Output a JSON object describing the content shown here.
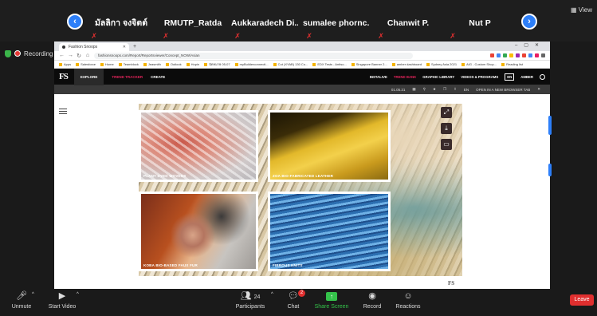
{
  "zoom": {
    "view_label": "View",
    "recording_label": "Recording",
    "participants": [
      {
        "name": "มัลลิกา จงจิตต์"
      },
      {
        "name": "RMUTP_Ratda"
      },
      {
        "name": "Aukkaradech Di..."
      },
      {
        "name": "sumalee phornc..."
      },
      {
        "name": "Chanwit P."
      },
      {
        "name": "Nut P"
      }
    ],
    "toolbar": {
      "unmute": "Unmute",
      "start_video": "Start Video",
      "participants": "Participants",
      "participant_count": "24",
      "chat": "Chat",
      "chat_badge": "2",
      "share_screen": "Share Screen",
      "record": "Record",
      "reactions": "Reactions",
      "leave": "Leave"
    }
  },
  "browser": {
    "tab_title": "Fashion Snoops",
    "url": "fashionsnoops.com/Report/Reportsviewer/Concept_NOW/Asian",
    "bookmarks": [
      "Apps",
      "Salesforce",
      "Home",
      "Teamblock",
      "Jeasmith",
      "Outlook",
      "Hopin",
      "นัดหมาย 05-07",
      "myBuilderconnecti...",
      "Cut (XYAB) 130 Co...",
      "EDX Tests - Antiso...",
      "Singapore Banner 2...",
      "amber dashboard",
      "Sydney Asia 2021",
      "AIG - Custom Shop...",
      "Reading list"
    ]
  },
  "site": {
    "logo": "FS",
    "nav": [
      "EXPLORE",
      "TREND TRACKER",
      "CREATE"
    ],
    "nav_right": [
      "INSTALIVE",
      "TREND BANK",
      "GRAPHIC LIBRARY",
      "VIDEOS & PROGRAMS"
    ],
    "lang": "EN",
    "user": "AMBER",
    "pdf_bar": [
      "01.05.21",
      "EN",
      "OPEN IN A NEW BROWSER TAB"
    ]
  },
  "board": {
    "cards": [
      {
        "label": "PLANT DYED WOVENS"
      },
      {
        "label": "ZOA BIO-FABRICATED LEATHER"
      },
      {
        "label": "KOBA BIO-BASED FAUX FUR"
      },
      {
        "label": "FIBROUS KNITS"
      }
    ],
    "mark": "FS"
  },
  "colors": {
    "zoom_blue": "#2d7ff9",
    "share_green": "#34c24a",
    "leave_red": "#e02f2f",
    "site_accent": "#e3245b"
  }
}
